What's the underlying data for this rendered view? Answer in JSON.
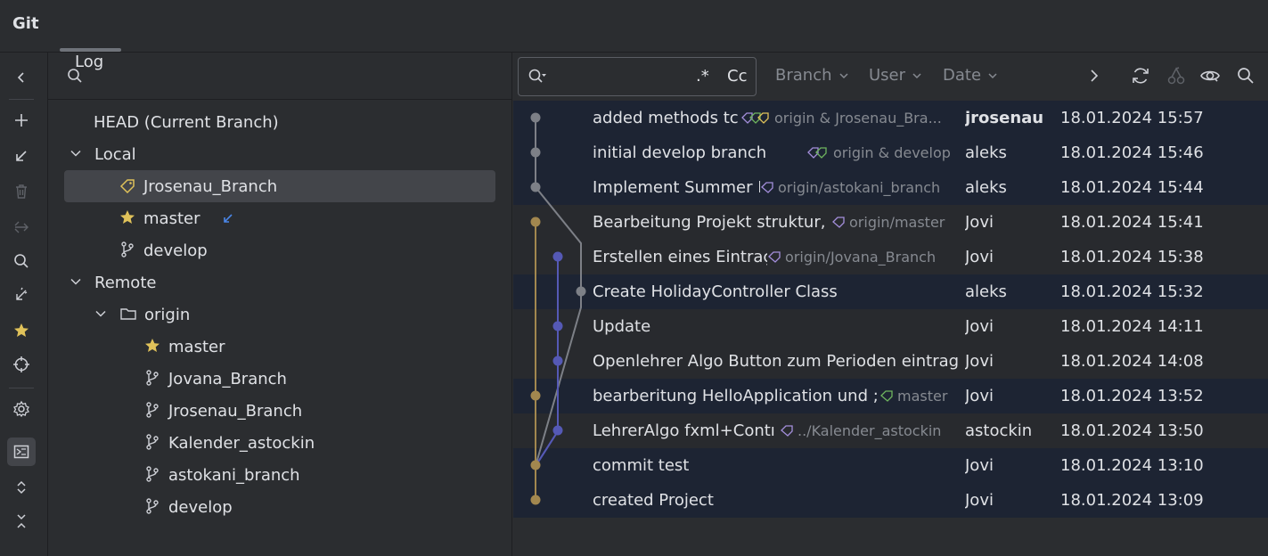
{
  "tabs": [
    {
      "label": "Git"
    },
    {
      "label": "Log"
    }
  ],
  "branches": {
    "head": "HEAD (Current Branch)",
    "local_label": "Local",
    "local": [
      {
        "name": "Jrosenau_Branch",
        "icon": "tag-icon",
        "selected": true
      },
      {
        "name": "master",
        "icon": "star-icon",
        "incoming": true
      },
      {
        "name": "develop",
        "icon": "branch-icon"
      }
    ],
    "remote_label": "Remote",
    "origin_label": "origin",
    "remote": [
      {
        "name": "master",
        "icon": "star-icon"
      },
      {
        "name": "Jovana_Branch",
        "icon": "branch-icon"
      },
      {
        "name": "Jrosenau_Branch",
        "icon": "branch-icon"
      },
      {
        "name": "Kalender_astockin",
        "icon": "branch-icon"
      },
      {
        "name": "astokani_branch",
        "icon": "branch-icon"
      },
      {
        "name": "develop",
        "icon": "branch-icon"
      }
    ]
  },
  "log": {
    "search": {
      "value": "",
      "regex": ".*",
      "case": "Cc"
    },
    "filters": {
      "branch": "Branch",
      "user": "User",
      "date": "Date"
    },
    "commits": [
      {
        "message": "added methods tc",
        "refs": "origin & Jrosenau_Bra...",
        "author": "jrosenau",
        "date": "18.01.2024 15:57"
      },
      {
        "message": "initial develop branch",
        "refs": "origin & develop",
        "author": "aleks",
        "date": "18.01.2024 15:46"
      },
      {
        "message": "Implement Summer I",
        "refs": "origin/astokani_branch",
        "author": "aleks",
        "date": "18.01.2024 15:44"
      },
      {
        "message": "Bearbeitung Projekt struktur,",
        "refs": "origin/master",
        "author": "Jovi",
        "date": "18.01.2024 15:41"
      },
      {
        "message": "Erstellen eines Eintraç",
        "refs": "origin/Jovana_Branch",
        "author": "Jovi",
        "date": "18.01.2024 15:38"
      },
      {
        "message": "Create HolidayController Class",
        "refs": "",
        "author": "aleks",
        "date": "18.01.2024 15:32"
      },
      {
        "message": "Update",
        "refs": "",
        "author": "Jovi",
        "date": "18.01.2024 14:11"
      },
      {
        "message": "Openlehrer Algo Button zum Perioden eintrag",
        "refs": "",
        "author": "Jovi",
        "date": "18.01.2024 14:08"
      },
      {
        "message": "bearberitung HelloApplication und ;",
        "refs": "master",
        "author": "Jovi",
        "date": "18.01.2024 13:52"
      },
      {
        "message": "LehrerAlgo fxml+Contı",
        "refs": "../Kalender_astockin",
        "author": "astockin",
        "date": "18.01.2024 13:50"
      },
      {
        "message": "commit test",
        "refs": "",
        "author": "Jovi",
        "date": "18.01.2024 13:10"
      },
      {
        "message": "created Project",
        "refs": "",
        "author": "Jovi",
        "date": "18.01.2024 13:09"
      }
    ]
  },
  "colors": {
    "graph_gray": "#7d8087",
    "graph_gold": "#a2874f",
    "graph_blue": "#5559b5",
    "tag_gold": "#e0c25a",
    "tag_green": "#6fb55f",
    "tag_purple": "#a48fdc",
    "incoming_blue": "#4a86e8"
  }
}
